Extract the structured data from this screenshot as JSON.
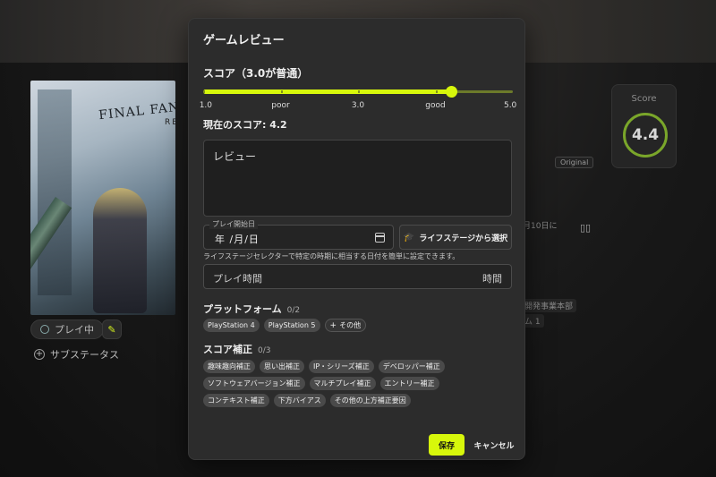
{
  "background": {
    "cover_title": "FINAL FANTASY VII",
    "cover_subtitle": "REMAKE",
    "status_chip": "プレイ中",
    "sub_status": "サブステータス",
    "score_card": {
      "label": "Score",
      "value": "4.4"
    },
    "original_badge": "Original",
    "date_fragment": "月10日に",
    "dev_fragment": "開発事業本部",
    "dev_fragment_2": "ム 1"
  },
  "modal": {
    "title": "ゲームレビュー",
    "score_label": "スコア（3.0が普通）",
    "slider": {
      "min": 1.0,
      "max": 5.0,
      "value": 4.2,
      "accent_color": "#d7f70b",
      "marks": [
        {
          "label": "1.0",
          "value": 1.0
        },
        {
          "label": "poor",
          "value": 2.0
        },
        {
          "label": "3.0",
          "value": 3.0
        },
        {
          "label": "good",
          "value": 4.0
        },
        {
          "label": "5.0",
          "value": 5.0
        }
      ]
    },
    "current_score": "現在のスコア: 4.2",
    "review_placeholder": "レビュー",
    "play_start": {
      "legend": "プレイ開始日",
      "value": "年 /月/日"
    },
    "life_stage_button": "ライフステージから選択",
    "helper_text": "ライフステージセレクターで特定の時期に相当する日付を簡単に設定できます。",
    "play_time": {
      "placeholder": "プレイ時間",
      "unit": "時間"
    },
    "platform": {
      "title": "プラットフォーム",
      "count": "0/2",
      "chips": [
        "PlayStation 4",
        "PlayStation 5"
      ],
      "more": "その他"
    },
    "score_adjust": {
      "title": "スコア補正",
      "count": "0/3",
      "chips": [
        "趣味趣向補正",
        "思い出補正",
        "IP・シリーズ補正",
        "デベロッパー補正",
        "ソフトウェアバージョン補正",
        "マルチプレイ補正",
        "エントリー補正",
        "コンテキスト補正",
        "下方バイアス",
        "その他の上方補正要因"
      ]
    },
    "save_label": "保存",
    "cancel_label": "キャンセル"
  }
}
